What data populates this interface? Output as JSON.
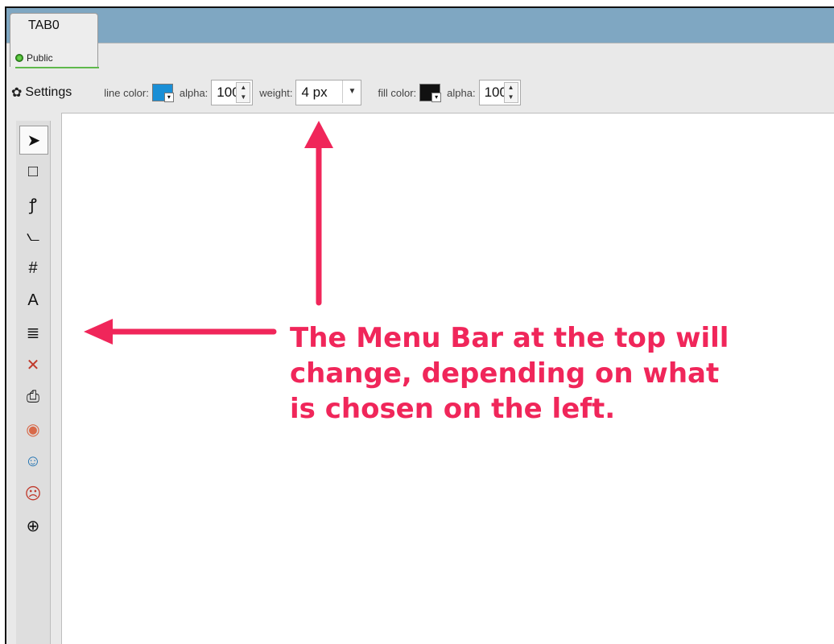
{
  "tab": {
    "title": "TAB0",
    "subtitle": "Public"
  },
  "toolbar": {
    "settings_label": "Settings",
    "line_color_label": "line color:",
    "line_alpha_label": "alpha:",
    "line_alpha_value": "100",
    "weight_label": "weight:",
    "weight_value": "4 px",
    "fill_color_label": "fill color:",
    "fill_alpha_label": "alpha:",
    "fill_alpha_value": "100",
    "line_color": "#1a8fd6",
    "fill_color": "#111111"
  },
  "tools": [
    {
      "name": "select-tool-icon",
      "glyph": "➤",
      "color": "#111"
    },
    {
      "name": "rectangle-tool-icon",
      "glyph": "□",
      "color": "#111"
    },
    {
      "name": "freehand-tool-icon",
      "glyph": "ꝭ",
      "color": "#111"
    },
    {
      "name": "axes-tool-icon",
      "glyph": "⦦",
      "color": "#111"
    },
    {
      "name": "grid-tool-icon",
      "glyph": "#",
      "color": "#111"
    },
    {
      "name": "text-tool-icon",
      "glyph": "A",
      "color": "#111"
    },
    {
      "name": "layers-tool-icon",
      "glyph": "≣",
      "color": "#111"
    },
    {
      "name": "delete-tool-icon",
      "glyph": "✕",
      "color": "#c0392b"
    },
    {
      "name": "print-tool-icon",
      "glyph": "⎙",
      "color": "#111"
    },
    {
      "name": "webcam-tool-icon",
      "glyph": "◉",
      "color": "#d86a4a"
    },
    {
      "name": "user-tool-icon",
      "glyph": "☺",
      "color": "#1b6fb0"
    },
    {
      "name": "remove-user-tool-icon",
      "glyph": "☹",
      "color": "#c0392b"
    },
    {
      "name": "add-page-tool-icon",
      "glyph": "⊕",
      "color": "#111"
    }
  ],
  "annotation": {
    "line1": "The Menu Bar at the top will",
    "line2": "change, depending on what",
    "line3": "is chosen on the left."
  }
}
